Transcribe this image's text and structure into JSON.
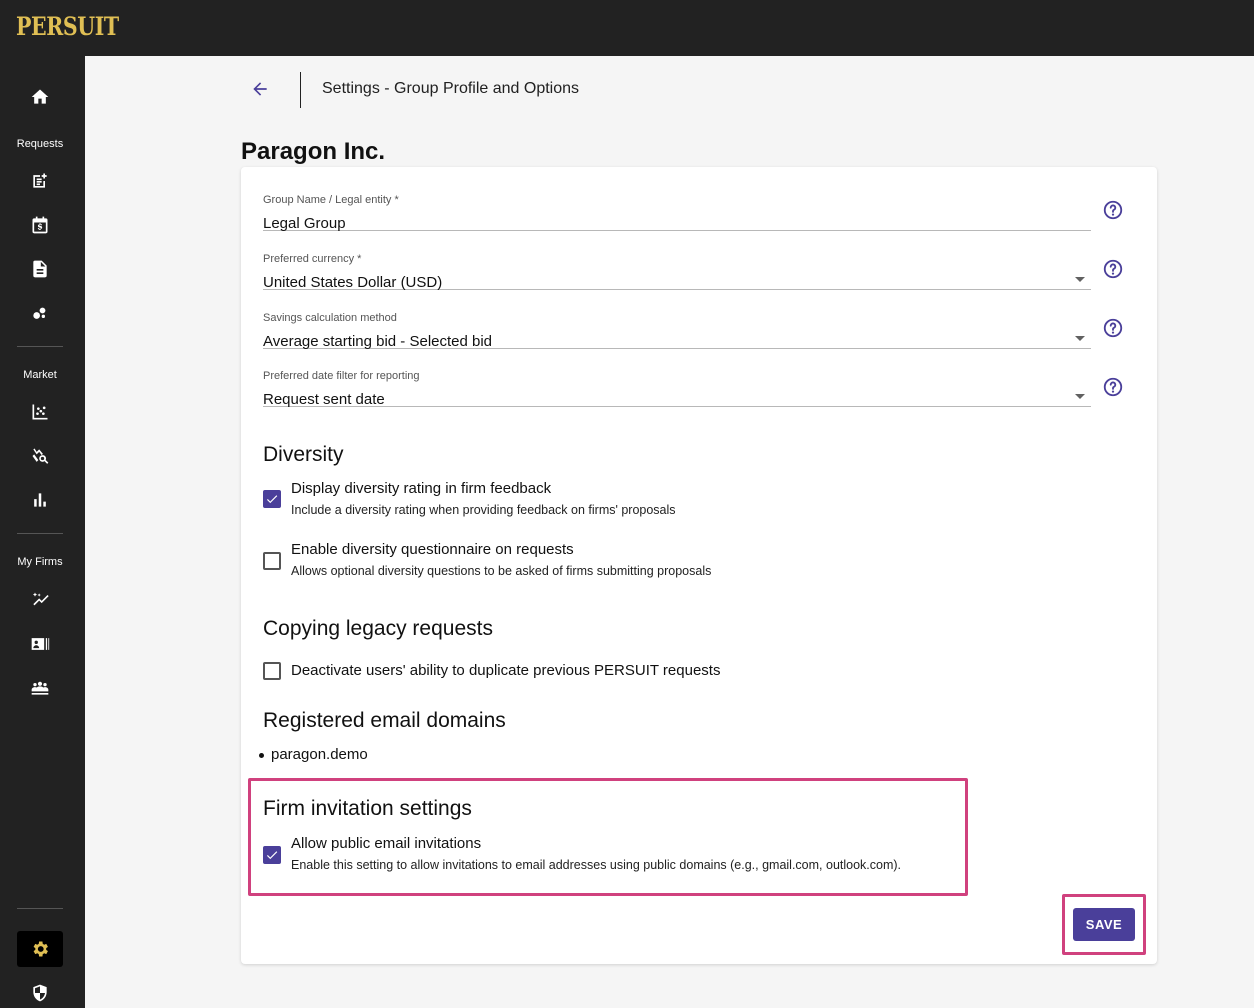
{
  "app": {
    "logo_text": "PERSUIT"
  },
  "sidebar": {
    "items": [
      {
        "icon": "home-icon"
      },
      {
        "label": "Requests"
      },
      {
        "icon": "new-request-icon"
      },
      {
        "icon": "calendar-dollar-icon"
      },
      {
        "icon": "document-icon"
      },
      {
        "icon": "bubbles-icon"
      },
      {
        "label": "Market"
      },
      {
        "icon": "scatter-chart-icon"
      },
      {
        "icon": "analytics-search-icon"
      },
      {
        "icon": "bar-chart-icon"
      },
      {
        "label": "My Firms"
      },
      {
        "icon": "sparkle-trend-icon"
      },
      {
        "icon": "contact-card-icon"
      },
      {
        "icon": "groups-icon"
      },
      {
        "icon": "gear-icon",
        "active": true
      },
      {
        "icon": "shield-icon"
      }
    ]
  },
  "header": {
    "back_icon": "arrow-left-icon",
    "subtitle": "Settings - Group Profile and Options"
  },
  "org": {
    "name": "Paragon Inc."
  },
  "form": {
    "group_name": {
      "label": "Group Name / Legal entity *",
      "value": "Legal Group"
    },
    "currency": {
      "label": "Preferred currency *",
      "value": "United States Dollar (USD)"
    },
    "savings": {
      "label": "Savings calculation method",
      "value": "Average starting bid - Selected bid"
    },
    "date_filter": {
      "label": "Preferred date filter for reporting",
      "value": "Request sent date"
    }
  },
  "diversity": {
    "title": "Diversity",
    "display_rating": {
      "checked": true,
      "title": "Display diversity rating in firm feedback",
      "desc": "Include a diversity rating when providing feedback on firms' proposals"
    },
    "questionnaire": {
      "checked": false,
      "title": "Enable diversity questionnaire on requests",
      "desc": "Allows optional diversity questions to be asked of firms submitting proposals"
    }
  },
  "legacy": {
    "title": "Copying legacy requests",
    "deactivate": {
      "checked": false,
      "title": "Deactivate users' ability to duplicate previous PERSUIT requests"
    }
  },
  "domains": {
    "title": "Registered email domains",
    "items": [
      "paragon.demo"
    ]
  },
  "invitations": {
    "title": "Firm invitation settings",
    "allow_public": {
      "checked": true,
      "title": "Allow public email invitations",
      "desc": "Enable this setting to allow invitations to email addresses using public domains (e.g., gmail.com, outlook.com)."
    }
  },
  "actions": {
    "save_label": "SAVE"
  },
  "colors": {
    "accent": "#4a3f9a",
    "highlight": "#d0417e",
    "logo": "#e0bf54",
    "sidebar": "#222222"
  }
}
